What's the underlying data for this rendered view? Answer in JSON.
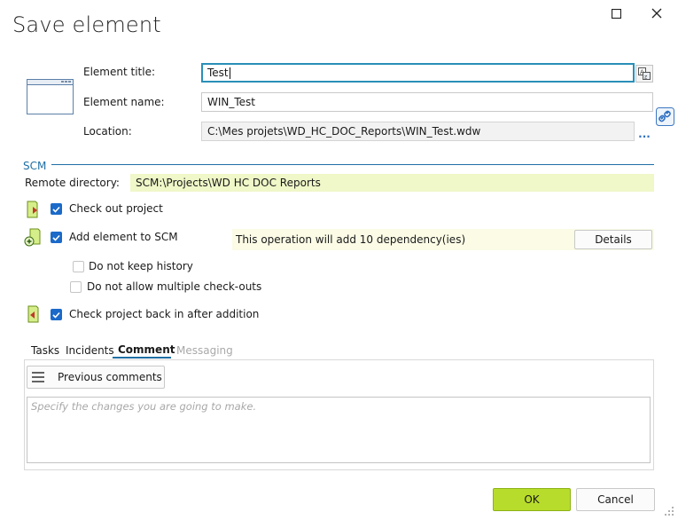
{
  "dialog": {
    "title": "Save element"
  },
  "window_controls": {
    "maximize_icon": "square-icon",
    "close_icon": "x-icon"
  },
  "form": {
    "element_title_label": "Element title:",
    "element_title_value": "Test",
    "element_name_label": "Element name:",
    "element_name_value": "WIN_Test",
    "location_label": "Location:",
    "location_value": "C:\\Mes projets\\WD_HC_DOC_Reports\\WIN_Test.wdw",
    "browse_label": "..."
  },
  "scm": {
    "section_label": "SCM",
    "remote_directory_label": "Remote directory:",
    "remote_directory_value": "SCM:\\Projects\\WD HC DOC Reports",
    "check_out_label": "Check out project",
    "check_out_checked": true,
    "add_element_label": "Add element to SCM",
    "add_element_checked": true,
    "operation_info": "This operation will add 10 dependency(ies)",
    "details_button": "Details",
    "no_history_label": "Do not keep history",
    "no_history_checked": false,
    "no_multiple_checkouts_label": "Do not allow multiple check-outs",
    "no_multiple_checkouts_checked": false,
    "check_back_in_label": "Check project back in after addition",
    "check_back_in_checked": true
  },
  "tabs": [
    {
      "label": "Tasks",
      "state": "normal"
    },
    {
      "label": "Incidents",
      "state": "normal"
    },
    {
      "label": "Comment",
      "state": "active"
    },
    {
      "label": "Messaging",
      "state": "disabled"
    }
  ],
  "comment": {
    "previous_comments_button": "Previous comments",
    "placeholder": "Specify the changes you are going to make."
  },
  "footer": {
    "ok_button": "OK",
    "cancel_button": "Cancel"
  },
  "colors": {
    "accent": "#1f6fa5",
    "ok_green": "#b8dc2b",
    "scm_yellow": "#f0f7c8",
    "checkbox_blue": "#1b6ac9"
  }
}
